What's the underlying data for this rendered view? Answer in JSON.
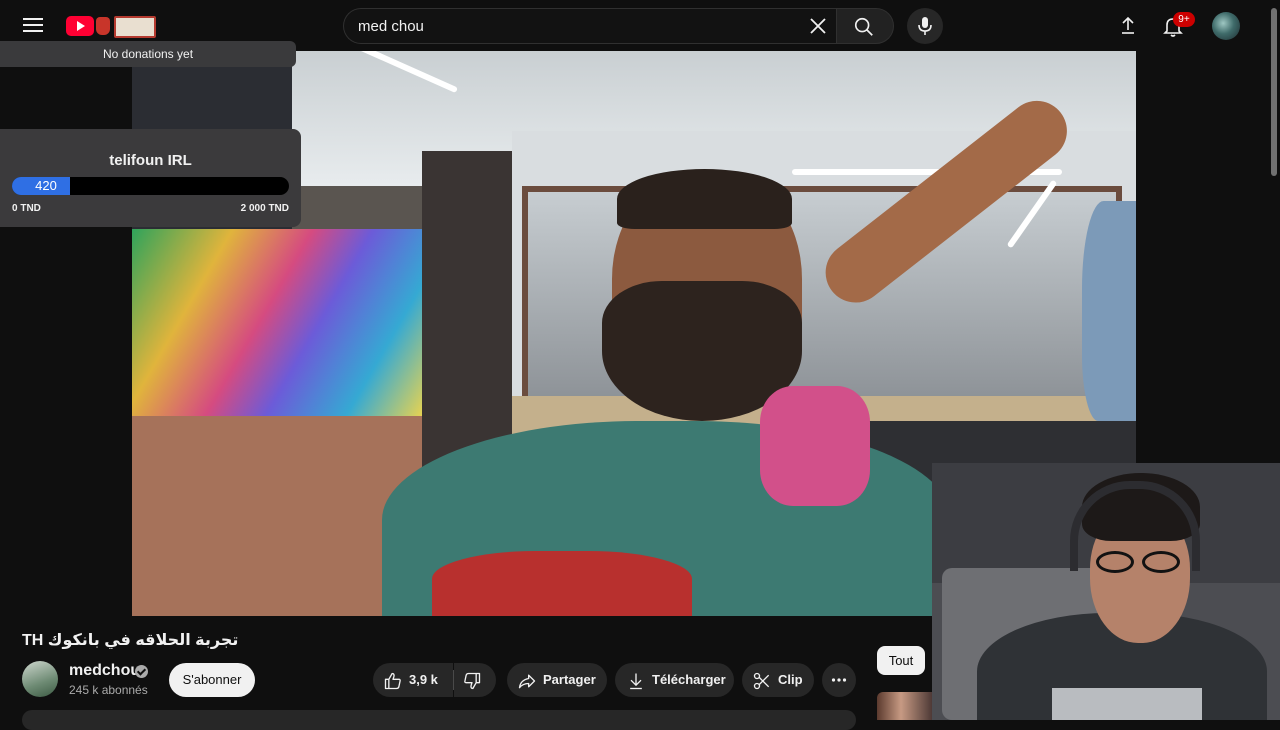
{
  "header": {
    "search": {
      "value": "med chou",
      "placeholder": ""
    },
    "notifications_badge": "9+",
    "icons": [
      "menu-icon",
      "youtube-logo",
      "close-icon",
      "search-icon",
      "mic-icon",
      "upload-icon",
      "bell-icon"
    ]
  },
  "overlay": {
    "donations_text": "No donations yet",
    "goal": {
      "title": "telifoun IRL",
      "current": "420",
      "current_value": 420,
      "max_value": 2000,
      "progress_fraction": 0.21,
      "min_label": "0 TND",
      "max_label": "2 000 TND"
    }
  },
  "video": {
    "title": "تجربة الحلاقه في بانكوك TH",
    "channel": {
      "name": "medchou",
      "subscribers": "245 k abonnés",
      "verified": true
    },
    "actions": {
      "subscribe": "S'abonner",
      "likes": "3,9 k",
      "share": "Partager",
      "download": "Télécharger",
      "clip": "Clip"
    }
  },
  "sidebar": {
    "chips": [
      "Tout"
    ]
  },
  "colors": {
    "background": "#0f0f0f",
    "accent_red": "#ff0033",
    "badge_red": "#cc0000",
    "progress_blue": "#2f6fe4",
    "pill_gray": "#272727"
  }
}
